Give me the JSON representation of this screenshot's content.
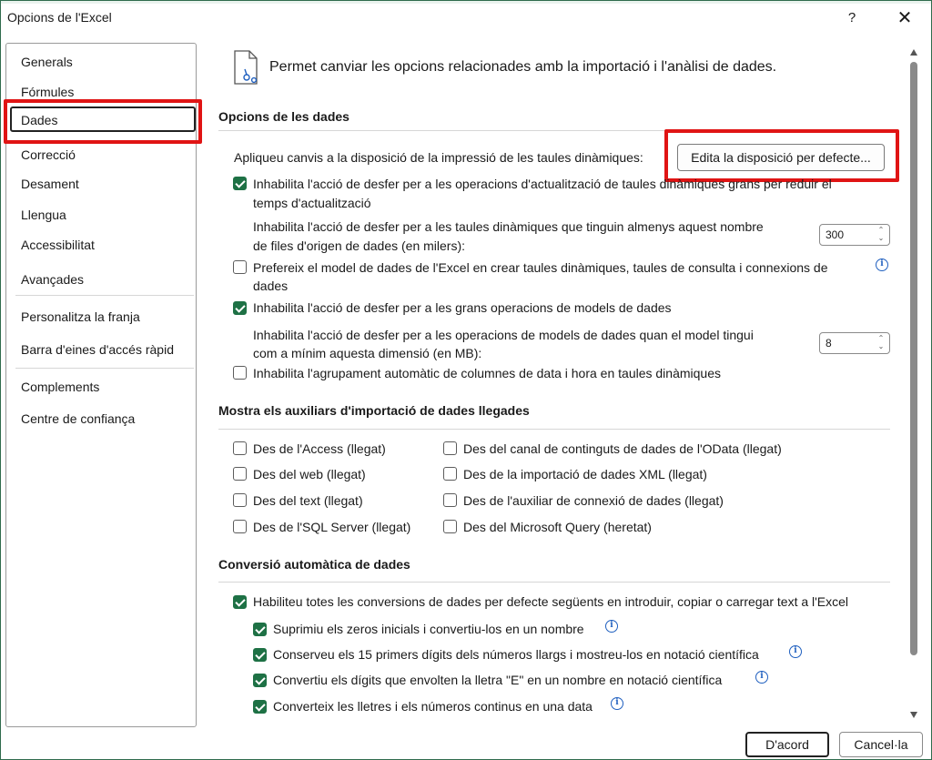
{
  "window": {
    "title": "Opcions de l'Excel",
    "help_glyph": "?",
    "close_glyph": "✕"
  },
  "nav": {
    "items": [
      {
        "label": "Generals"
      },
      {
        "label": "Fórmules"
      },
      {
        "label": "Dades",
        "selected": true
      },
      {
        "label": "Correcció"
      },
      {
        "label": "Desament"
      },
      {
        "label": "Llengua"
      },
      {
        "label": "Accessibilitat"
      },
      {
        "label": "Avançades"
      },
      {
        "label": "Personalitza la franja"
      },
      {
        "label": "Barra d'eines d'accés ràpid"
      },
      {
        "label": "Complements"
      },
      {
        "label": "Centre de confiança"
      }
    ]
  },
  "header": {
    "text": "Permet canviar les opcions relacionades amb la importació i l'anàlisi de dades.",
    "icon": "document-data-icon"
  },
  "data_options": {
    "title": "Opcions de les dades",
    "layout_label": "Apliqueu canvis a la disposició de la impressió de les taules dinàmiques:",
    "layout_button": "Edita la disposició per defecte...",
    "opt1": {
      "line1": "Inhabilita l'acció de desfer per a les operacions d'actualització de taules dinàmiques grans per reduir el",
      "line2": "temps d'actualització",
      "checked": true
    },
    "opt1_sub": {
      "line1": "Inhabilita l'acció de desfer per a les taules dinàmiques que tinguin almenys aquest nombre",
      "line2": "de files d'origen de dades (en milers):",
      "value": "300"
    },
    "opt2": {
      "line1": "Prefereix el model de dades de l'Excel en crear taules dinàmiques, taules de consulta i connexions de",
      "line2": "dades",
      "checked": false
    },
    "opt3": {
      "label": "Inhabilita l'acció de desfer per a les grans operacions de models de dades",
      "checked": true
    },
    "opt3_sub": {
      "line1": "Inhabilita l'acció de desfer per a les operacions de models de dades quan el model tingui",
      "line2": "com a mínim aquesta dimensió (en MB):",
      "value": "8"
    },
    "opt4": {
      "label": "Inhabilita l'agrupament automàtic de columnes de data i hora en taules dinàmiques",
      "checked": false
    }
  },
  "legacy_wizards": {
    "title": "Mostra els auxiliars d'importació de dades llegades",
    "left": [
      {
        "label": "Des de l'Access (llegat)",
        "checked": false
      },
      {
        "label": "Des del web (llegat)",
        "checked": false
      },
      {
        "label": "Des del text (llegat)",
        "checked": false
      },
      {
        "label": "Des de l'SQL Server (llegat)",
        "checked": false
      }
    ],
    "right": [
      {
        "label": "Des del canal de continguts de dades de l'OData (llegat)",
        "checked": false
      },
      {
        "label": "Des de la importació de dades XML (llegat)",
        "checked": false
      },
      {
        "label": "Des de l'auxiliar de connexió de dades (llegat)",
        "checked": false
      },
      {
        "label": "Des del Microsoft Query (heretat)",
        "checked": false
      }
    ]
  },
  "auto_conversion": {
    "title": "Conversió automàtica de dades",
    "main": {
      "label": "Habiliteu totes les conversions de dades per defecte següents en introduir, copiar o carregar text a l'Excel",
      "checked": true
    },
    "subs": [
      {
        "label": "Suprimiu els zeros inicials i convertiu-los en un nombre",
        "checked": true
      },
      {
        "label": "Conserveu els 15 primers dígits dels números llargs i mostreu-los en notació científica",
        "checked": true
      },
      {
        "label": "Convertiu els dígits que envolten la lletra \"E\" en un nombre en notació científica",
        "checked": true
      },
      {
        "label": "Converteix les lletres i els números continus en una data",
        "checked": true
      }
    ]
  },
  "footer": {
    "ok": "D'acord",
    "cancel": "Cancel·la"
  },
  "colors": {
    "check_green": "#1e7145",
    "highlight_red": "#e01414",
    "info_blue": "#1f5fbf"
  }
}
